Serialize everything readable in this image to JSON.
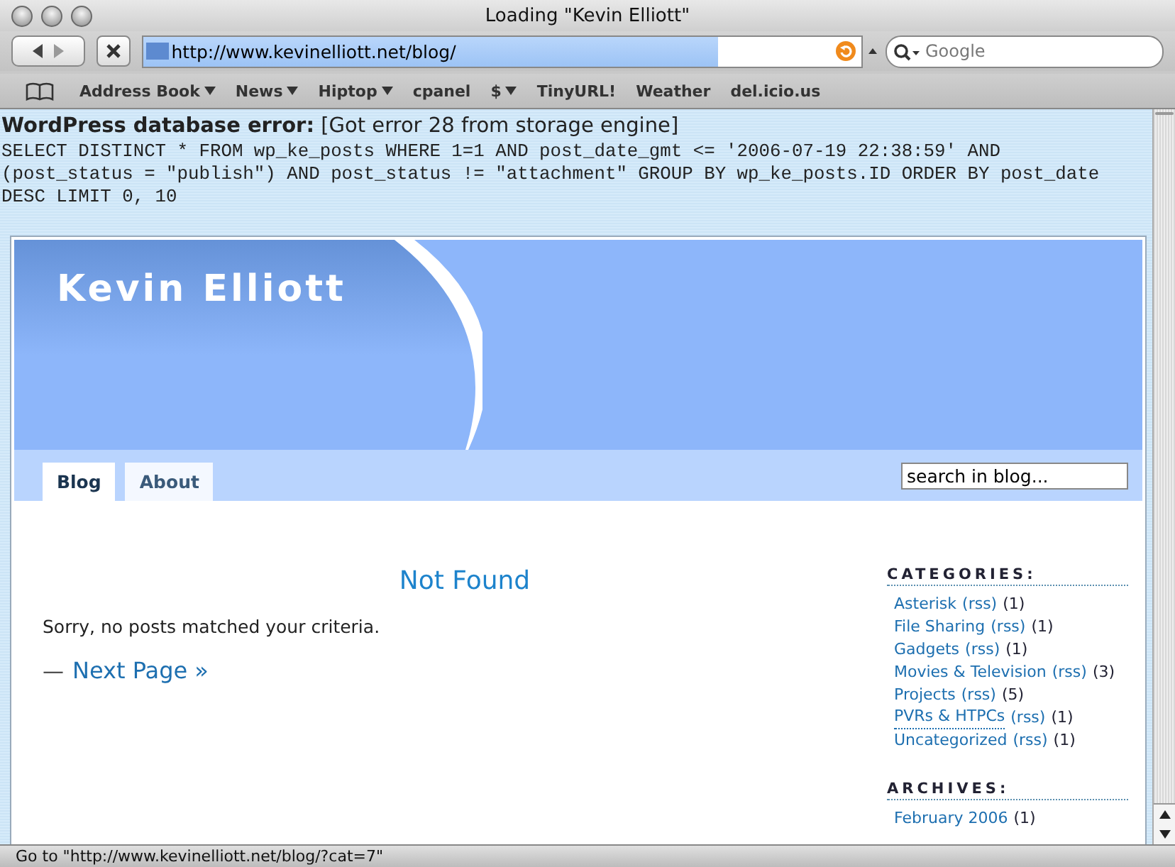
{
  "window": {
    "title": "Loading \"Kevin Elliott\""
  },
  "address_bar": {
    "url": "http://www.kevinelliott.net/blog/",
    "level": 0.8
  },
  "search": {
    "placeholder": "Google"
  },
  "bookmarks": [
    {
      "label": "Address Book",
      "menu": true
    },
    {
      "label": "News",
      "menu": true
    },
    {
      "label": "Hiptop",
      "menu": true
    },
    {
      "label": "cpanel",
      "menu": false
    },
    {
      "label": "$",
      "menu": true
    },
    {
      "label": "TinyURL!",
      "menu": false
    },
    {
      "label": "Weather",
      "menu": false
    },
    {
      "label": "del.icio.us",
      "menu": false
    }
  ],
  "error": {
    "heading": "WordPress database error:",
    "message": "[Got error 28 from storage engine]",
    "sql_lines": [
      "SELECT DISTINCT * FROM wp_ke_posts WHERE 1=1 AND post_date_gmt <= '2006-07-19 22:38:59' AND",
      "(post_status = \"publish\") AND post_status != \"attachment\" GROUP BY wp_ke_posts.ID ORDER BY post_date",
      "DESC LIMIT 0, 10"
    ]
  },
  "blog": {
    "title": "Kevin Elliott",
    "tabs": [
      {
        "label": "Blog",
        "selected": true
      },
      {
        "label": "About",
        "selected": false
      }
    ],
    "search_value": "search in blog...",
    "heading": "Not Found",
    "message": "Sorry, no posts matched your criteria.",
    "pager_dash": "—",
    "next_page": "Next Page »",
    "categories_title": "CATEGORIES:",
    "categories": [
      {
        "name": "Asterisk",
        "rss": "(rss)",
        "count": "(1)",
        "hovered": false
      },
      {
        "name": "File Sharing",
        "rss": "(rss)",
        "count": "(1)",
        "hovered": false
      },
      {
        "name": "Gadgets",
        "rss": "(rss)",
        "count": "(1)",
        "hovered": false
      },
      {
        "name": "Movies & Television",
        "rss": "(rss)",
        "count": "(3)",
        "hovered": false
      },
      {
        "name": "Projects",
        "rss": "(rss)",
        "count": "(5)",
        "hovered": false
      },
      {
        "name": "PVRs & HTPCs",
        "rss": "(rss)",
        "count": "(1)",
        "hovered": true
      },
      {
        "name": "Uncategorized",
        "rss": "(rss)",
        "count": "(1)",
        "hovered": false
      }
    ],
    "archives_title": "ARCHIVES:",
    "archives": [
      {
        "name": "February 2006",
        "count": "(1)"
      }
    ]
  },
  "status_bar": {
    "text": "Go to \"http://www.kevinelliott.net/blog/?cat=7\""
  }
}
